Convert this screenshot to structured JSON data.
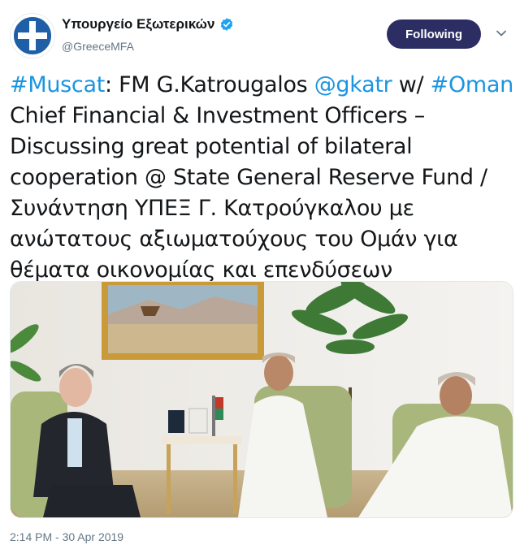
{
  "account": {
    "display_name": "Υπουργείο Εξωτερικών",
    "handle": "@GreeceMFA",
    "verified": true,
    "avatar_icon": "greek-flag-cross-icon"
  },
  "follow_button": {
    "label": "Following"
  },
  "tweet": {
    "segments": [
      {
        "type": "hashtag",
        "text": "#Muscat"
      },
      {
        "type": "text",
        "text": ": FM G.Katrougalos "
      },
      {
        "type": "mention",
        "text": "@gkatr"
      },
      {
        "type": "text",
        "text": " w/ "
      },
      {
        "type": "hashtag",
        "text": "#Oman"
      },
      {
        "type": "text",
        "text": " Chief Financial & Investment Officers – Discussing great potential of bilateral cooperation @ State General Reserve Fund / Συνάντηση ΥΠΕΞ Γ. Κατρούγκαλου με ανώτατους αξιωματούχους του Ομάν για θέματα οικονομίας και επενδύσεων"
      }
    ]
  },
  "photo": {
    "name": "meeting-photo"
  },
  "timestamp": "2:14 PM - 30 Apr 2019",
  "colors": {
    "link": "#1b95e0",
    "follow_bg": "#2c2d63",
    "verified": "#1da1f2",
    "muted": "#657786"
  }
}
